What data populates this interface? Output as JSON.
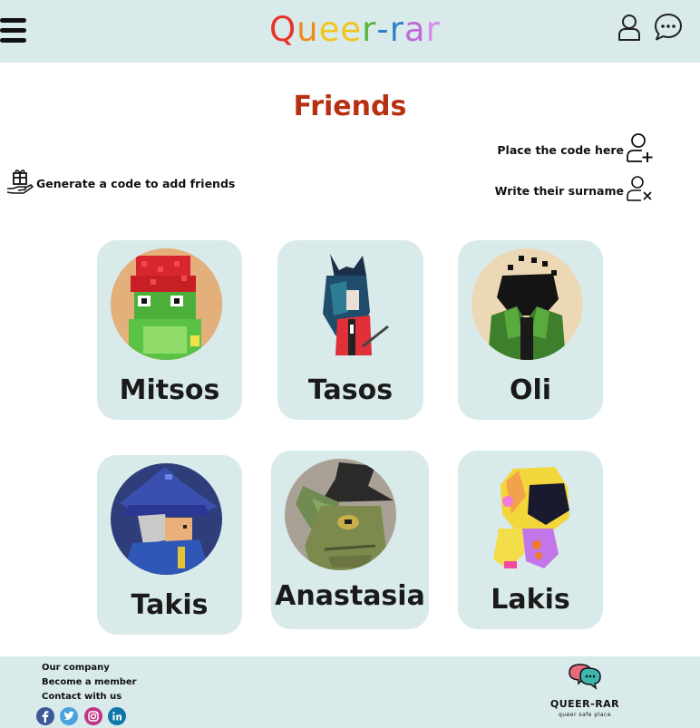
{
  "header": {
    "logo_letters": [
      {
        "ch": "Q",
        "color": "#e8352c"
      },
      {
        "ch": "u",
        "color": "#f08a1c"
      },
      {
        "ch": "e",
        "color": "#f2c41c"
      },
      {
        "ch": "e",
        "color": "#f2c41c"
      },
      {
        "ch": "r",
        "color": "#58b43a"
      },
      {
        "ch": "-",
        "color": "#2f82c9"
      },
      {
        "ch": "r",
        "color": "#2f82c9"
      },
      {
        "ch": "a",
        "color": "#c06ad8"
      },
      {
        "ch": "r",
        "color": "#d78ae8"
      }
    ],
    "icons": [
      "hamburger-menu-icon",
      "user-icon",
      "chat-bubble-icon"
    ]
  },
  "page": {
    "title": "Friends",
    "title_color": "#b83012"
  },
  "actions": {
    "generate_code": "Generate a code to add friends",
    "place_code": "Place the code here",
    "write_surname": "Write their surname"
  },
  "friends": [
    {
      "name": "Mitsos"
    },
    {
      "name": "Tasos"
    },
    {
      "name": "Oli"
    },
    {
      "name": "Takis"
    },
    {
      "name": "Anastasia"
    },
    {
      "name": "Lakis"
    }
  ],
  "footer": {
    "links": [
      "Our company",
      "Become a member",
      "Contact with us"
    ],
    "social": [
      "facebook-icon",
      "twitter-icon",
      "instagram-icon",
      "linkedin-icon"
    ],
    "brand_name": "QUEER-RAR",
    "brand_tagline": "queer safe place"
  },
  "colors": {
    "panel": "#d9eaea",
    "accent": "#b83012"
  }
}
